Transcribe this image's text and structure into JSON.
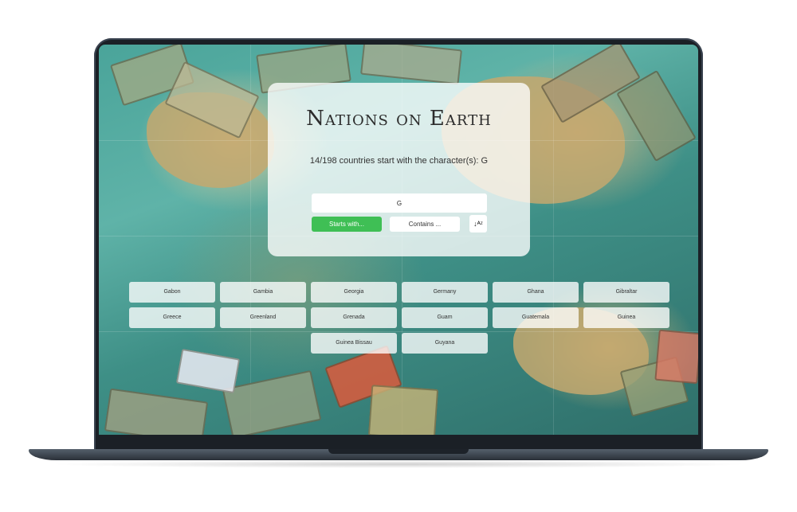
{
  "app": {
    "title": "Nations on Earth",
    "status": "14/198 countries start with the character(s): G"
  },
  "search": {
    "value": "G"
  },
  "filters": {
    "starts_with_label": "Starts with...",
    "contains_label": "Contains ...",
    "active": "starts_with",
    "active_color": "#3fbf55"
  },
  "sort": {
    "icon": "sort-alpha-icon",
    "glyph": "↓ᴬᶻ"
  },
  "countries": [
    "Gabon",
    "Gambia",
    "Georgia",
    "Germany",
    "Ghana",
    "Gibraltar",
    "Greece",
    "Greenland",
    "Grenada",
    "Guam",
    "Guatemala",
    "Guinea",
    "Guinea Bissau",
    "Guyana"
  ]
}
